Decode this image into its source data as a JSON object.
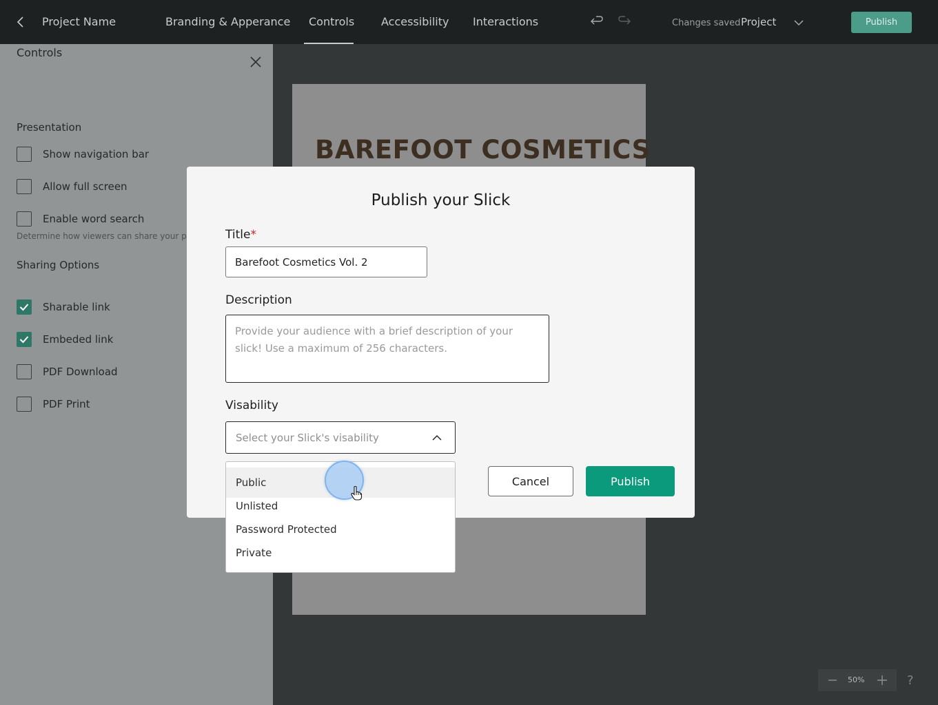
{
  "topbar": {
    "project_name": "Project Name",
    "tabs": [
      {
        "label": "Branding & Apperance"
      },
      {
        "label": "Controls"
      },
      {
        "label": "Accessibility"
      },
      {
        "label": "Interactions"
      }
    ],
    "active_tab": "Controls",
    "status": "Changes saved",
    "project_selector": "Project",
    "publish_label": "Publish"
  },
  "panel": {
    "title": "Controls",
    "presentation": {
      "heading": "Presentation",
      "options": [
        {
          "label": "Show navigation bar",
          "checked": false
        },
        {
          "label": "Allow full screen",
          "checked": false
        },
        {
          "label": "Enable word search",
          "checked": false
        }
      ]
    },
    "sharing": {
      "heading": "Sharing Options",
      "description": "Determine how viewers can share your p",
      "options": [
        {
          "label": "Sharable link",
          "checked": true
        },
        {
          "label": "Embeded link",
          "checked": true
        },
        {
          "label": "PDF Download",
          "checked": false
        },
        {
          "label": "PDF Print",
          "checked": false
        }
      ]
    }
  },
  "slide": {
    "title": "BAREFOOT COSMETICS"
  },
  "zoom": {
    "value": "50%",
    "help": "?"
  },
  "modal": {
    "title": "Publish your Slick",
    "title_label": "Title",
    "required_mark": "*",
    "title_value": "Barefoot Cosmetics Vol. 2",
    "description_label": "Description",
    "description_placeholder": "Provide your audience with a brief description of your slick! Use a maximum of 256 characters.",
    "visibility_label": "Visability",
    "visibility_placeholder": "Select your Slick's visability",
    "visibility_options": [
      "Public",
      "Unlisted",
      "Password Protected",
      "Private"
    ],
    "hovered_option": "Public",
    "cancel_label": "Cancel",
    "publish_label": "Publish"
  },
  "colors": {
    "accent": "#0b9a7c",
    "checkbox_checked": "#2f7868",
    "required": "#c0272d"
  }
}
